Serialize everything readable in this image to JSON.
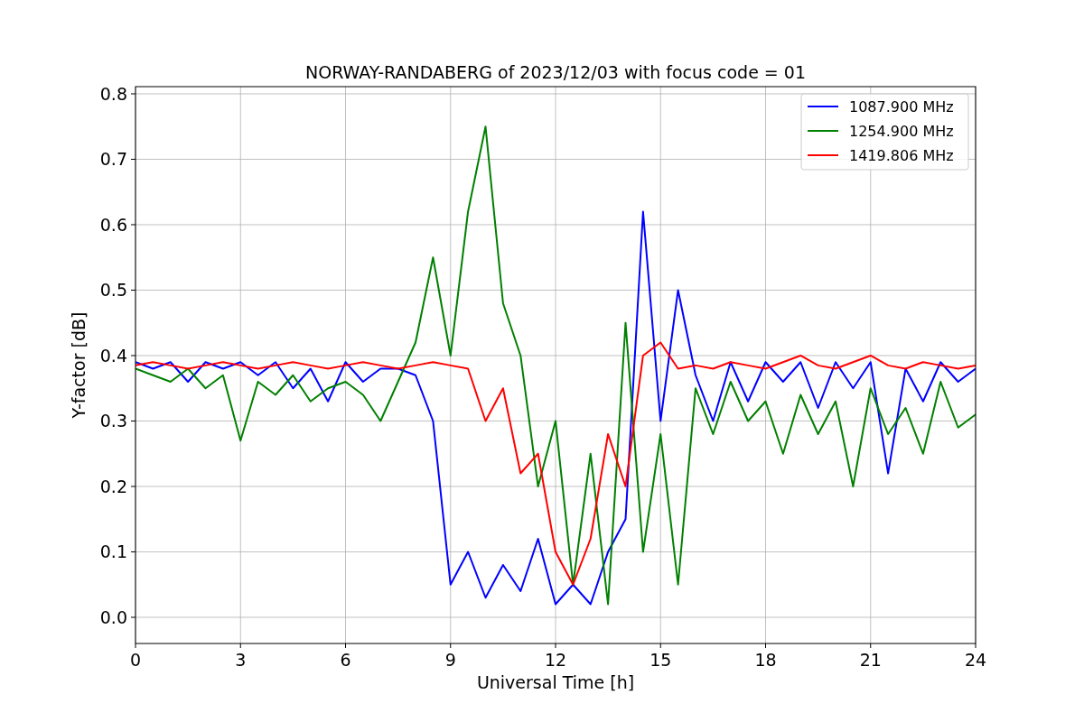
{
  "figure": {
    "chart_data": {
      "type": "line",
      "title": "NORWAY-RANDABERG of 2023/12/03 with focus code = 01",
      "xlabel": "Universal Time [h]",
      "ylabel": "Y-factor [dB]",
      "x": [
        0,
        0.5,
        1,
        1.5,
        2,
        2.5,
        3,
        3.5,
        4,
        4.5,
        5,
        5.5,
        6,
        6.5,
        7,
        7.5,
        8,
        8.5,
        9,
        9.5,
        10,
        10.5,
        11,
        11.5,
        12,
        12.5,
        13,
        13.5,
        14,
        14.5,
        15,
        15.5,
        16,
        16.5,
        17,
        17.5,
        18,
        18.5,
        19,
        19.5,
        20,
        20.5,
        21,
        21.5,
        22,
        22.5,
        23,
        23.5,
        24
      ],
      "series": [
        {
          "name": "1087.900 MHz",
          "color": "#0000ff",
          "values": [
            0.39,
            0.38,
            0.39,
            0.36,
            0.39,
            0.38,
            0.39,
            0.37,
            0.39,
            0.35,
            0.38,
            0.33,
            0.39,
            0.36,
            0.38,
            0.38,
            0.37,
            0.3,
            0.05,
            0.1,
            0.03,
            0.08,
            0.04,
            0.12,
            0.02,
            0.05,
            0.02,
            0.1,
            0.15,
            0.62,
            0.3,
            0.5,
            0.37,
            0.3,
            0.39,
            0.33,
            0.39,
            0.36,
            0.39,
            0.32,
            0.39,
            0.35,
            0.39,
            0.22,
            0.38,
            0.33,
            0.39,
            0.36,
            0.38
          ]
        },
        {
          "name": "1254.900 MHz",
          "color": "#008000",
          "values": [
            0.38,
            0.37,
            0.36,
            0.38,
            0.35,
            0.37,
            0.27,
            0.36,
            0.34,
            0.37,
            0.33,
            0.35,
            0.36,
            0.34,
            0.3,
            0.36,
            0.42,
            0.55,
            0.4,
            0.62,
            0.75,
            0.48,
            0.4,
            0.2,
            0.3,
            0.05,
            0.25,
            0.02,
            0.45,
            0.1,
            0.28,
            0.05,
            0.35,
            0.28,
            0.36,
            0.3,
            0.33,
            0.25,
            0.34,
            0.28,
            0.33,
            0.2,
            0.35,
            0.28,
            0.32,
            0.25,
            0.36,
            0.29,
            0.31
          ]
        },
        {
          "name": "1419.806 MHz",
          "color": "#ff0000",
          "values": [
            0.385,
            0.39,
            0.385,
            0.38,
            0.385,
            0.39,
            0.385,
            0.38,
            0.385,
            0.39,
            0.385,
            0.38,
            0.385,
            0.39,
            0.385,
            0.38,
            0.385,
            0.39,
            0.385,
            0.38,
            0.3,
            0.35,
            0.22,
            0.25,
            0.1,
            0.05,
            0.12,
            0.28,
            0.2,
            0.4,
            0.42,
            0.38,
            0.385,
            0.38,
            0.39,
            0.385,
            0.38,
            0.39,
            0.4,
            0.385,
            0.38,
            0.39,
            0.4,
            0.385,
            0.38,
            0.39,
            0.385,
            0.38,
            0.385
          ]
        }
      ],
      "grid": true,
      "legend": true,
      "xlim": [
        0,
        24
      ],
      "ylim": [
        -0.04,
        0.811
      ],
      "xticks": [
        0,
        3,
        6,
        9,
        12,
        15,
        18,
        21,
        24
      ],
      "yticks": [
        {
          "value": 0,
          "label": "0.0"
        },
        {
          "value": 0.1,
          "label": "0.1"
        },
        {
          "value": 0.2,
          "label": "0.2"
        },
        {
          "value": 0.3,
          "label": "0.3"
        },
        {
          "value": 0.4,
          "label": "0.4"
        },
        {
          "value": 0.5,
          "label": "0.5"
        },
        {
          "value": 0.6,
          "label": "0.6"
        },
        {
          "value": 0.7,
          "label": "0.7"
        },
        {
          "value": 0.8,
          "label": "0.8"
        }
      ]
    }
  }
}
